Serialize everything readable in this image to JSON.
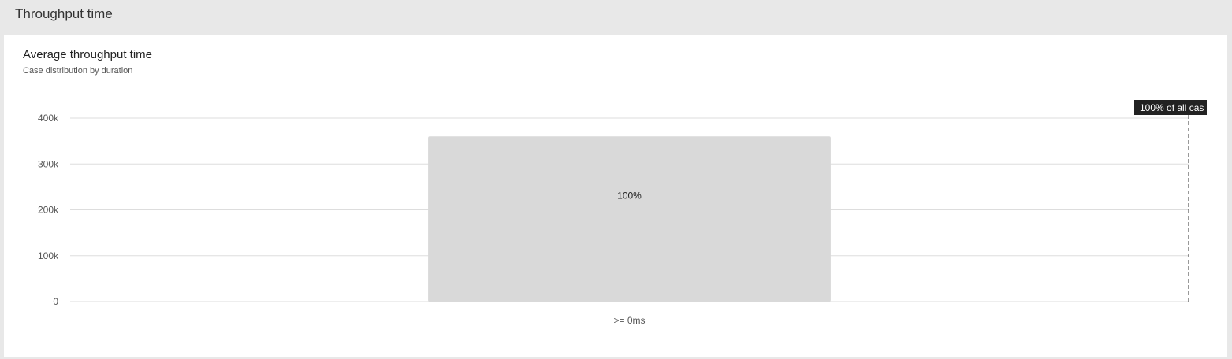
{
  "header": {
    "title": "Throughput time"
  },
  "card": {
    "title": "Average throughput time",
    "subtitle": "Case distribution by duration"
  },
  "colors": {
    "bar": "#d9d9d9",
    "grid": "#dddddd",
    "marker_bg": "#222222",
    "marker_line": "#333333"
  },
  "chart_data": {
    "type": "bar",
    "title": "Average throughput time",
    "subtitle": "Case distribution by duration",
    "categories": [
      ">= 0ms"
    ],
    "values": [
      360000
    ],
    "data_labels": [
      "100%"
    ],
    "ylim": [
      0,
      400000
    ],
    "yticks": [
      0,
      100000,
      200000,
      300000,
      400000
    ],
    "ytick_labels": [
      "0",
      "100k",
      "200k",
      "300k",
      "400k"
    ],
    "grid": true,
    "marker": {
      "label": "100% of all cas",
      "position": "right"
    }
  }
}
